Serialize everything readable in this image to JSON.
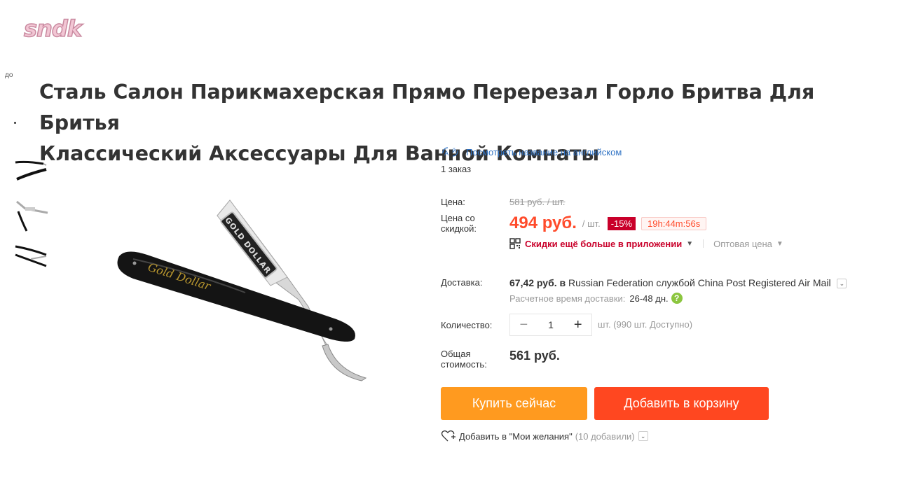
{
  "watermark": "sndk",
  "breadcrumb_stub": "до",
  "product": {
    "title_line1": "Сталь Салон Парикмахерская Прямо Перерезал Горло Бритва Для Бритья",
    "title_line2": "Классический Аксессуары Для Ванной Комнаты",
    "image_alt_text": "GOLD DOLLAR"
  },
  "translate": {
    "icon": "translate-icon",
    "label": "Посмотреть название на английском"
  },
  "orders": "1 заказ",
  "price": {
    "label": "Цена:",
    "old_price": "581 руб. / шт.",
    "discount_label_line1": "Цена со",
    "discount_label_line2": "скидкой:",
    "discount_price": "494 руб.",
    "per_unit": "/ шт.",
    "discount_badge": "-15%",
    "timer": "19h:44m:56s",
    "accent_color": "#ff4b2b"
  },
  "app_promo": {
    "icon": "qr-code-icon",
    "text": "Скидки ещё больше в приложении",
    "wholesale": "Оптовая цена"
  },
  "shipping": {
    "label": "Доставка:",
    "cost": "67,42 руб.",
    "in": "в",
    "destination": "Russian Federation",
    "via": "службой",
    "carrier": "China Post Registered Air Mail",
    "estimate_label": "Расчетное время доставки:",
    "estimate_value": "26-48 дн.",
    "help": "?"
  },
  "quantity": {
    "label": "Количество:",
    "minus": "−",
    "value": "1",
    "plus": "+",
    "stock": "шт. (990 шт. Доступно)"
  },
  "total": {
    "label_line1": "Общая",
    "label_line2": "стоимость:",
    "value": "561 руб."
  },
  "buttons": {
    "buy_now": "Купить сейчас",
    "add_to_cart": "Добавить в корзину",
    "buy_color": "#ff9a1f",
    "cart_color": "#ff4720"
  },
  "wishlist": {
    "icon": "heart-plus-icon",
    "label": "Добавить в \"Мои желания\"",
    "count": "(10 добавили)"
  }
}
